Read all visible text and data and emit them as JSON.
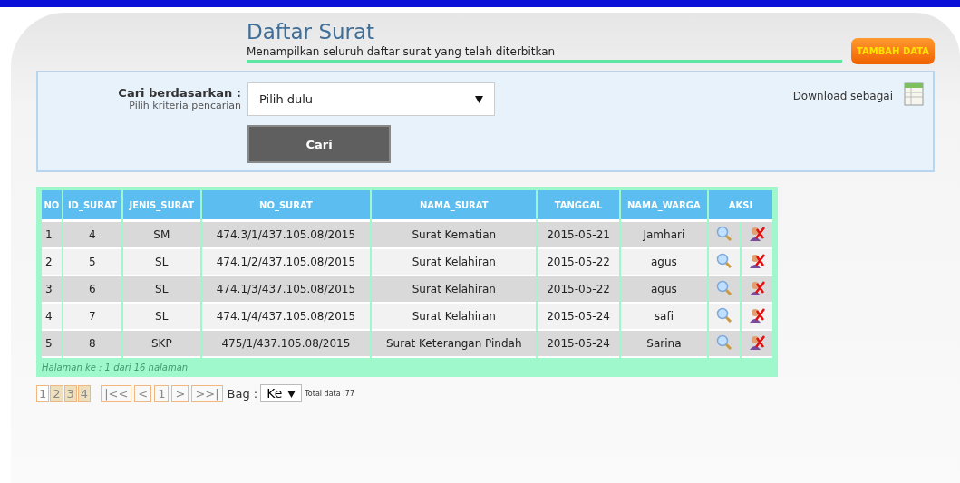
{
  "header": {
    "title": "Daftar Surat",
    "subtitle": "Menampilkan seluruh daftar surat yang telah diterbitkan",
    "add_button": "TAMBAH DATA"
  },
  "search": {
    "label": "Cari berdasarkan :",
    "hint": "Pilih kriteria pencarian",
    "select_value": "Pilih dulu",
    "button": "Cari",
    "download_label": "Download sebagai"
  },
  "table": {
    "columns": [
      "NO",
      "ID_SURAT",
      "JENIS_SURAT",
      "NO_SURAT",
      "NAMA_SURAT",
      "TANGGAL",
      "NAMA_WARGA",
      "AKSI"
    ],
    "rows": [
      {
        "cells": [
          "1",
          "4",
          "SM",
          "474.3/1/437.105.08/2015",
          "Surat Kematian",
          "2015-05-21",
          "Jamhari"
        ]
      },
      {
        "cells": [
          "2",
          "5",
          "SL",
          "474.1/2/437.105.08/2015",
          "Surat Kelahiran",
          "2015-05-22",
          "agus"
        ]
      },
      {
        "cells": [
          "3",
          "6",
          "SL",
          "474.1/3/437.105.08/2015",
          "Surat Kelahiran",
          "2015-05-22",
          "agus"
        ]
      },
      {
        "cells": [
          "4",
          "7",
          "SL",
          "474.1/4/437.105.08/2015",
          "Surat Kelahiran",
          "2015-05-24",
          "safi"
        ]
      },
      {
        "cells": [
          "5",
          "8",
          "SKP",
          "475/1/437.105.08/2015",
          "Surat Keterangan Pindah",
          "2015-05-24",
          "Sarina"
        ]
      }
    ],
    "footer": "Halaman ke : 1 dari 16 halaman"
  },
  "pagination": {
    "pages": [
      {
        "label": "1",
        "selected": true
      },
      {
        "label": "2",
        "selected": false
      },
      {
        "label": "3",
        "selected": false
      },
      {
        "label": "4",
        "selected": false
      }
    ],
    "nav": [
      "|<<",
      "<",
      "1",
      ">",
      ">>|"
    ],
    "jump_label": "Bag :",
    "jump_value": "Ke",
    "total": "Total data :77"
  }
}
